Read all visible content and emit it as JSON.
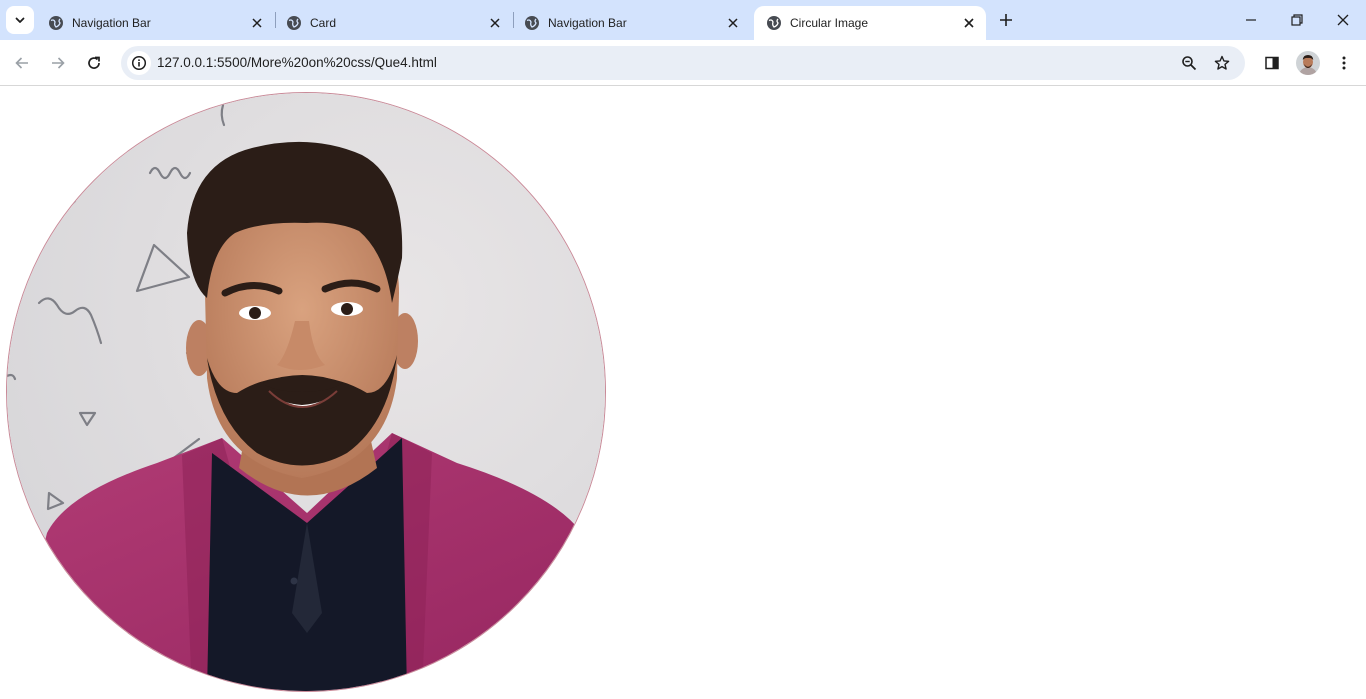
{
  "browser": {
    "tabs": [
      {
        "title": "Navigation Bar",
        "active": false
      },
      {
        "title": "Card",
        "active": false
      },
      {
        "title": "Navigation Bar",
        "active": false
      },
      {
        "title": "Circular Image",
        "active": true
      }
    ],
    "url": "127.0.0.1:5500/More%20on%20css/Que4.html"
  },
  "page": {
    "image": {
      "shape": "circle",
      "subject": "smiling man with beard in magenta blazer and black shirt",
      "background": "light grey wall with doodled triangles and squiggles"
    }
  },
  "colors": {
    "tabstrip": "#d3e3fd",
    "omnibox": "#e9eef6",
    "blazer": "#a8306a",
    "shirt": "#141828",
    "skin": "#c98a66",
    "hair": "#2b1d17",
    "wall": "#e3e1e2"
  }
}
